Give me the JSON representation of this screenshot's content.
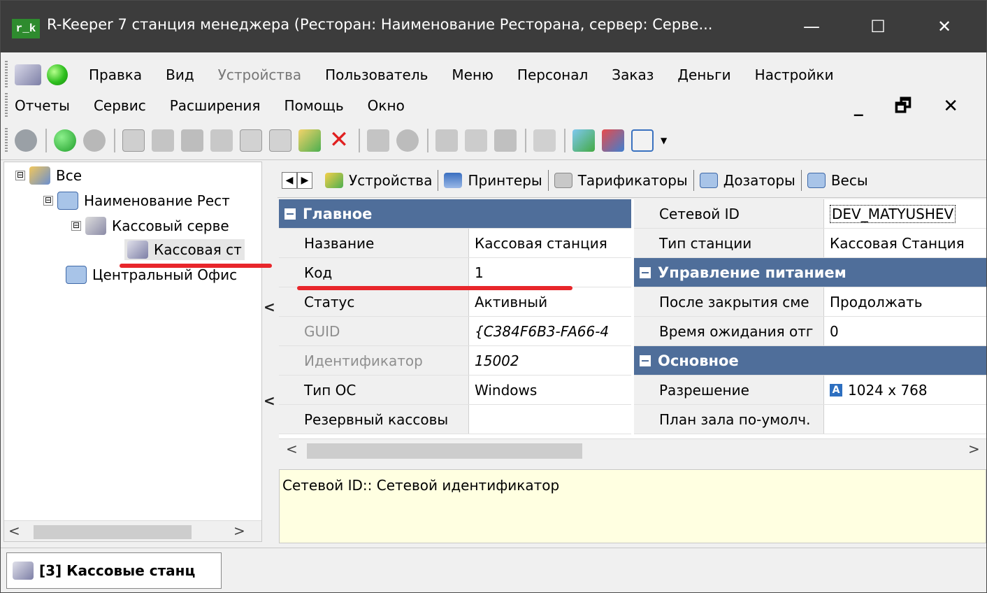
{
  "window": {
    "app_icon_text": "r_k",
    "title": "R-Keeper 7 станция менеджера (Ресторан: Наименование Ресторана, сервер: Серве...",
    "minimize_glyph": "—",
    "maximize_glyph": "☐",
    "close_glyph": "✕"
  },
  "menu": {
    "row1": [
      "Правка",
      "Вид",
      "Устройства",
      "Пользователь",
      "Меню",
      "Персонал",
      "Заказ",
      "Деньги",
      "Настройки"
    ],
    "row2": [
      "Отчеты",
      "Сервис",
      "Расширения",
      "Помощь",
      "Окно"
    ],
    "disabled_item": "Устройства",
    "mdi_controls": "_ 🗗 ✕"
  },
  "toolbar": {
    "icons": [
      "refresh-icon",
      "back-icon",
      "forward-icon",
      "new-doc-icon",
      "print-icon",
      "print-preview-icon",
      "rename-icon",
      "copy-doc-icon",
      "paste-doc-icon",
      "move-up-icon",
      "delete-icon",
      "save-icon",
      "cancel-icon",
      "copy-icon",
      "cut-icon",
      "paste-icon",
      "search-icon",
      "filter-icon",
      "export-icon",
      "grid-view-icon"
    ]
  },
  "tree": {
    "items": [
      {
        "label": "Все",
        "expander": "⊟"
      },
      {
        "label": "Наименование Рест",
        "expander": "⊟"
      },
      {
        "label": "Кассовый серве",
        "expander": "⊟"
      },
      {
        "label": "Кассовая ст",
        "expander": ""
      },
      {
        "label": "Центральный Офис",
        "expander": ""
      }
    ],
    "scroll_left": "<",
    "scroll_right": ">"
  },
  "splitter": {
    "arrow": "<"
  },
  "tabs": {
    "nav_left": "◀",
    "nav_right": "▶",
    "items": [
      "Устройства",
      "Принтеры",
      "Тарификаторы",
      "Дозаторы",
      "Весы"
    ]
  },
  "properties": {
    "left": {
      "section": "Главное",
      "rows": [
        {
          "key": "Название",
          "value": "Кассовая станция",
          "disabled": false
        },
        {
          "key": "Код",
          "value": "1",
          "disabled": false
        },
        {
          "key": "Статус",
          "value": "Активный",
          "disabled": false
        },
        {
          "key": "GUID",
          "value": "{C384F6B3-FA66-4",
          "disabled": true
        },
        {
          "key": "Идентификатор",
          "value": "15002",
          "disabled": true
        },
        {
          "key": "Тип ОС",
          "value": "Windows",
          "disabled": false
        },
        {
          "key": "Резервный кассовы",
          "value": "",
          "disabled": false
        }
      ]
    },
    "right": {
      "rows_top": [
        {
          "key": "Сетевой ID",
          "value": "DEV_MATYUSHEV"
        },
        {
          "key": "Тип станции",
          "value": "Кассовая Станция"
        }
      ],
      "section_power": "Управление питанием",
      "rows_power": [
        {
          "key": "После закрытия сме",
          "value": "Продолжать"
        },
        {
          "key": "Время ожидания отг",
          "value": "0"
        }
      ],
      "section_main": "Основное",
      "rows_main": [
        {
          "key": "Разрешение",
          "value": "1024 x 768",
          "icon_letter": "A"
        },
        {
          "key": "План зала по-умолч.",
          "value": ""
        }
      ]
    },
    "scroll_left": "<",
    "scroll_right": ">"
  },
  "description": "Сетевой ID:: Сетевой идентификатор",
  "status_tab": "[3] Кассовые станц",
  "colors": {
    "titlebar": "#3c3c3c",
    "section_header": "#4f6e9a",
    "description_bg": "#ffffe1",
    "annotation_red": "#e8262b"
  }
}
